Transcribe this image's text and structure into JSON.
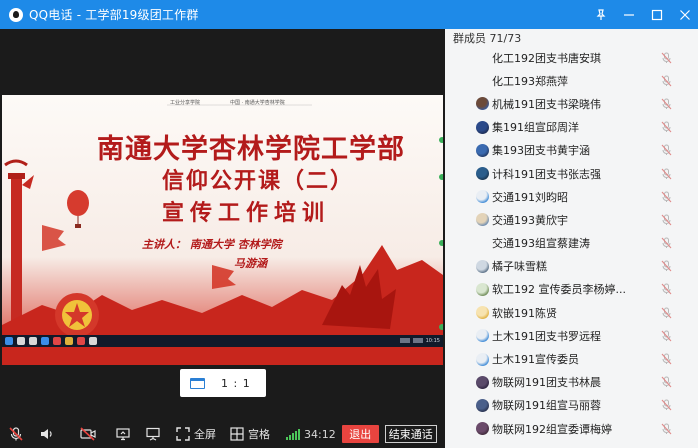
{
  "window": {
    "title": "QQ电话 - 工学部19级团工作群"
  },
  "slide": {
    "top_small_left": "工业分享学院",
    "top_small_right": "中国 · 南通大学杏林学院",
    "title_line1": "南通大学杏林学院工学部",
    "title_line2": "信仰公开课（二）",
    "title_line3": "宣传工作培训",
    "speaker_line1": "主讲人：  南通大学  杏林学院",
    "speaker_line2": "马游涵",
    "taskbar_time": "10:15"
  },
  "zoom": {
    "ratio_label": "1 : 1"
  },
  "controls": {
    "fullscreen_label": "全屏",
    "grid_label": "宫格",
    "timer": "34:12",
    "exit_label": "退出",
    "end_call_label": "结束通话"
  },
  "members": {
    "header": "群成员 71/73",
    "items": [
      {
        "name": "化工192团支书唐安琪",
        "avatar": [
          "#f5f5f5",
          "#f5f5f5"
        ]
      },
      {
        "name": "化工193郑燕萍",
        "avatar": [
          "#f5f5f5",
          "#f5f5f5"
        ]
      },
      {
        "name": "机械191团支书梁晓伟",
        "avatar": [
          "#6b4a3a",
          "#3a5a9a"
        ]
      },
      {
        "name": "集191组宣邱周洋",
        "avatar": [
          "#2b4a8a",
          "#1f2e55"
        ]
      },
      {
        "name": "集193团支书黄宇涵",
        "avatar": [
          "#3a6ab0",
          "#223a66"
        ]
      },
      {
        "name": "计科191团支书张志强",
        "avatar": [
          "#2a5d8c",
          "#1a3550"
        ]
      },
      {
        "name": "交通191刘昀昭",
        "avatar": [
          "#e9eef4",
          "#3a88d6"
        ]
      },
      {
        "name": "交通193黄欣宇",
        "avatar": [
          "#e3d3b8",
          "#6a8ab0"
        ]
      },
      {
        "name": "交通193组宣蔡建涛",
        "avatar": [
          "#f5f5f5",
          "#f5f5f5"
        ]
      },
      {
        "name": "橘子味雪糕",
        "avatar": [
          "#cfd8e2",
          "#5a6f86"
        ]
      },
      {
        "name": "软工192 宣传委员李杨婷...",
        "avatar": [
          "#d9e6d0",
          "#6d8a55"
        ]
      },
      {
        "name": "软嵌191陈贤",
        "avatar": [
          "#f7e3b0",
          "#e0b040"
        ]
      },
      {
        "name": "土木191团支书罗远程",
        "avatar": [
          "#e9eef4",
          "#3a88d6"
        ]
      },
      {
        "name": "土木191宣传委员",
        "avatar": [
          "#e9eef4",
          "#3a88d6"
        ]
      },
      {
        "name": "物联网191团支书林晨",
        "avatar": [
          "#5a4a6a",
          "#2e2440"
        ]
      },
      {
        "name": "物联网191组宣马丽蓉",
        "avatar": [
          "#4a5f8a",
          "#2a3350"
        ]
      },
      {
        "name": "物联网192组宣委谭梅婷",
        "avatar": [
          "#6a4a6a",
          "#402a3a"
        ]
      }
    ]
  },
  "colors": {
    "titlebar": "#1e8ae8",
    "exit_button": "#e8443f",
    "slide_title": "#b31b1b",
    "signal": "#4cc65a"
  }
}
